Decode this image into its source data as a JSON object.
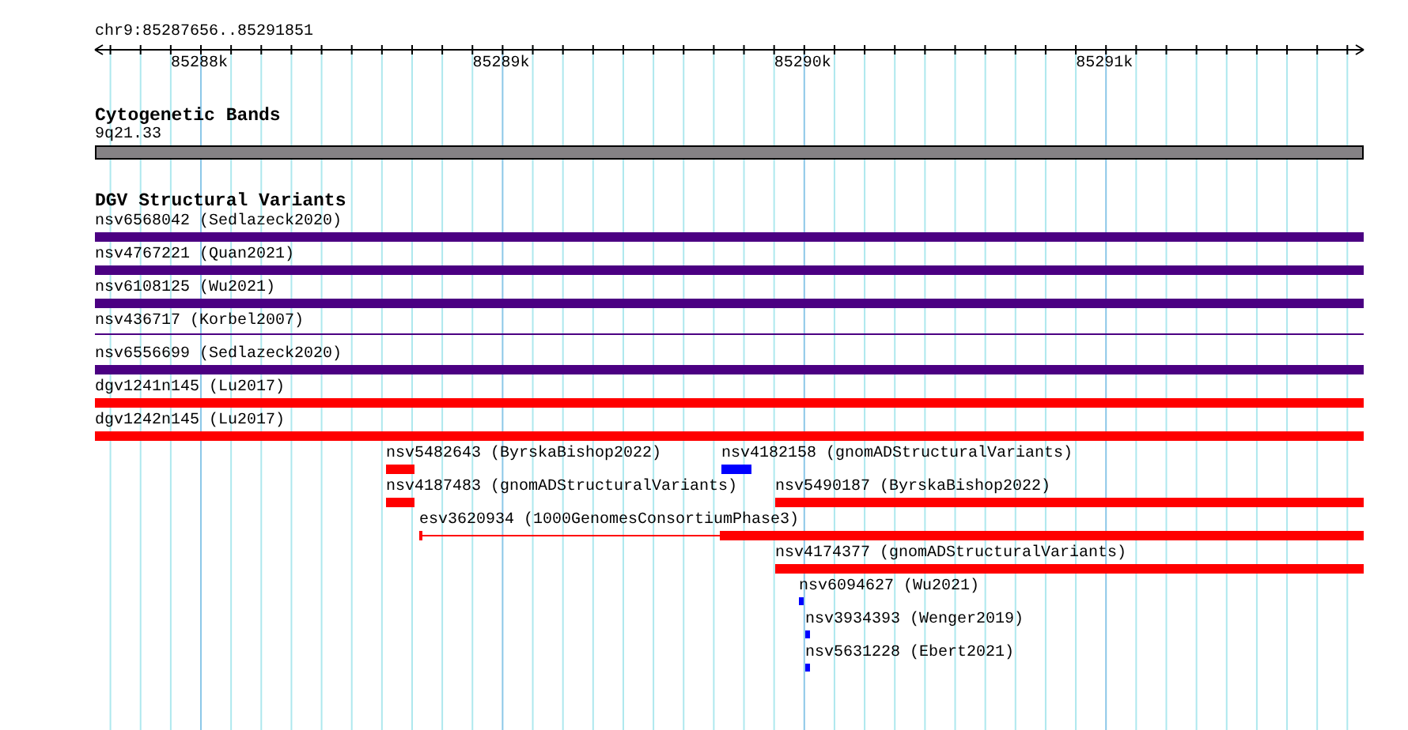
{
  "ruler": {
    "location": "chr9:85287656..85291851",
    "ticks": [
      "85288k",
      "85289k",
      "85290k",
      "85291k"
    ]
  },
  "tracks": [
    {
      "title": "Cytogenetic Bands",
      "features": [
        {
          "label": "9q21.33",
          "kind": "band",
          "color": "#858285"
        }
      ]
    },
    {
      "title": "DGV Structural Variants",
      "features": [
        {
          "label": "nsv6568042 (Sedlazeck2020)",
          "kind": "bar",
          "color": "#4b0082"
        },
        {
          "label": "nsv4767221 (Quan2021)",
          "kind": "bar",
          "color": "#4b0082"
        },
        {
          "label": "nsv6108125 (Wu2021)",
          "kind": "bar",
          "color": "#4b0082"
        },
        {
          "label": "nsv436717 (Korbel2007)",
          "kind": "line",
          "color": "#4b0082"
        },
        {
          "label": "nsv6556699 (Sedlazeck2020)",
          "kind": "bar",
          "color": "#4b0082"
        },
        {
          "label": "dgv1241n145 (Lu2017)",
          "kind": "bar",
          "color": "#ff0000"
        },
        {
          "label": "dgv1242n145 (Lu2017)",
          "kind": "bar",
          "color": "#ff0000"
        },
        {
          "label": "nsv5482643 (ByrskaBishop2022)",
          "kind": "bar",
          "color": "#ff0000"
        },
        {
          "label": "nsv4182158 (gnomADStructuralVariants)",
          "kind": "bar",
          "color": "#0000ff"
        },
        {
          "label": "nsv4187483 (gnomADStructuralVariants)",
          "kind": "bar",
          "color": "#ff0000"
        },
        {
          "label": "nsv5490187 (ByrskaBishop2022)",
          "kind": "bar",
          "color": "#ff0000"
        },
        {
          "label": "esv3620934 (1000GenomesConsortiumPhase3)",
          "kind": "gapped",
          "color": "#ff0000"
        },
        {
          "label": "nsv4174377 (gnomADStructuralVariants)",
          "kind": "bar",
          "color": "#ff0000"
        },
        {
          "label": "nsv6094627 (Wu2021)",
          "kind": "small",
          "color": "#0000ff"
        },
        {
          "label": "nsv3934393 (Wenger2019)",
          "kind": "small",
          "color": "#0000ff"
        },
        {
          "label": "nsv5631228 (Ebert2021)",
          "kind": "small",
          "color": "#0000ff"
        }
      ]
    }
  ]
}
